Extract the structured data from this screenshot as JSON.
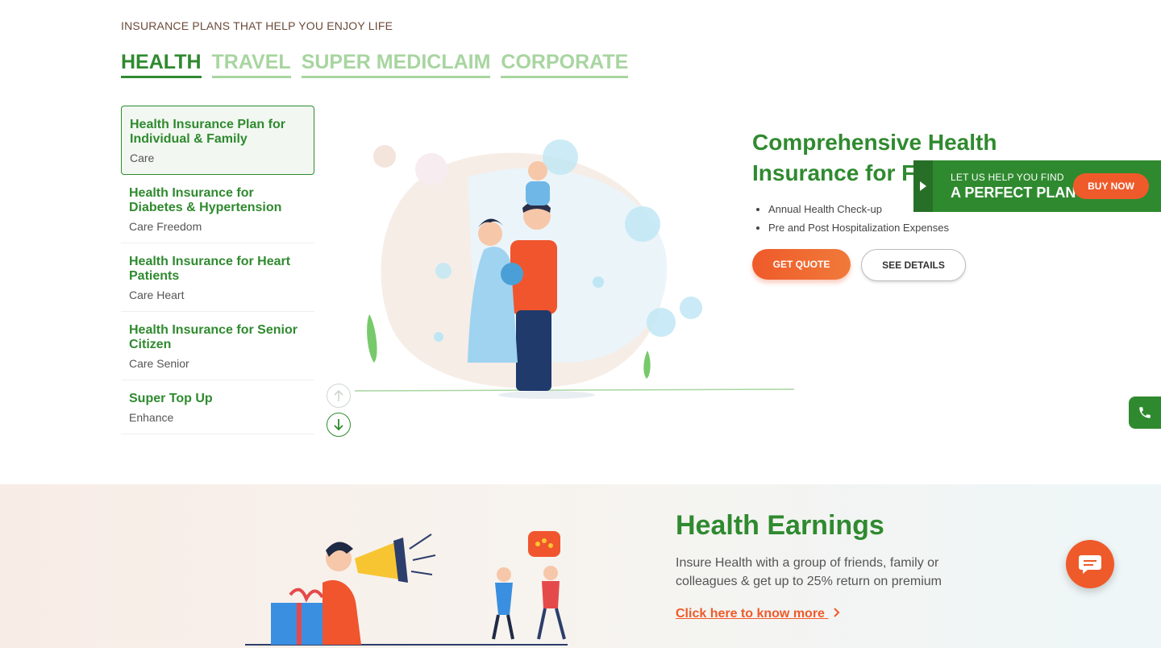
{
  "section": {
    "eyebrow": "INSURANCE PLANS THAT HELP YOU ENJOY LIFE",
    "tabs": [
      {
        "label": "HEALTH",
        "active": true
      },
      {
        "label": "TRAVEL",
        "active": false
      },
      {
        "label": "SUPER MEDICLAIM",
        "active": false
      },
      {
        "label": "CORPORATE",
        "active": false
      }
    ]
  },
  "plans": [
    {
      "title": "Health Insurance Plan for Individual & Family",
      "sub": "Care"
    },
    {
      "title": "Health Insurance for Diabetes & Hypertension",
      "sub": "Care Freedom"
    },
    {
      "title": "Health Insurance for Heart Patients",
      "sub": "Care Heart"
    },
    {
      "title": "Health Insurance for Senior Citizen",
      "sub": "Care Senior"
    },
    {
      "title": "Super Top Up",
      "sub": "Enhance"
    }
  ],
  "detail": {
    "title": "Comprehensive Health Insurance for Family",
    "bullets": [
      "Annual Health Check-up",
      "Pre and Post Hospitalization Expenses"
    ],
    "get_quote": "GET QUOTE",
    "see_details": "SEE DETAILS"
  },
  "help_banner": {
    "small": "LET US HELP YOU FIND",
    "big": "A PERFECT PLAN",
    "buy_now": "BUY NOW"
  },
  "earnings": {
    "title": "Health Earnings",
    "text": "Insure Health with a group of friends, family or colleagues & get up to 25% return on premium",
    "link": "Click here to know more"
  },
  "colors": {
    "primary_green": "#2f8a2f",
    "accent_orange": "#ef5a2a",
    "inactive_tab": "#a8d5a0"
  },
  "icons": [
    "arrow-up-icon",
    "arrow-down-icon",
    "play-arrow-icon",
    "phone-icon",
    "chat-icon",
    "chevron-right-icon"
  ]
}
